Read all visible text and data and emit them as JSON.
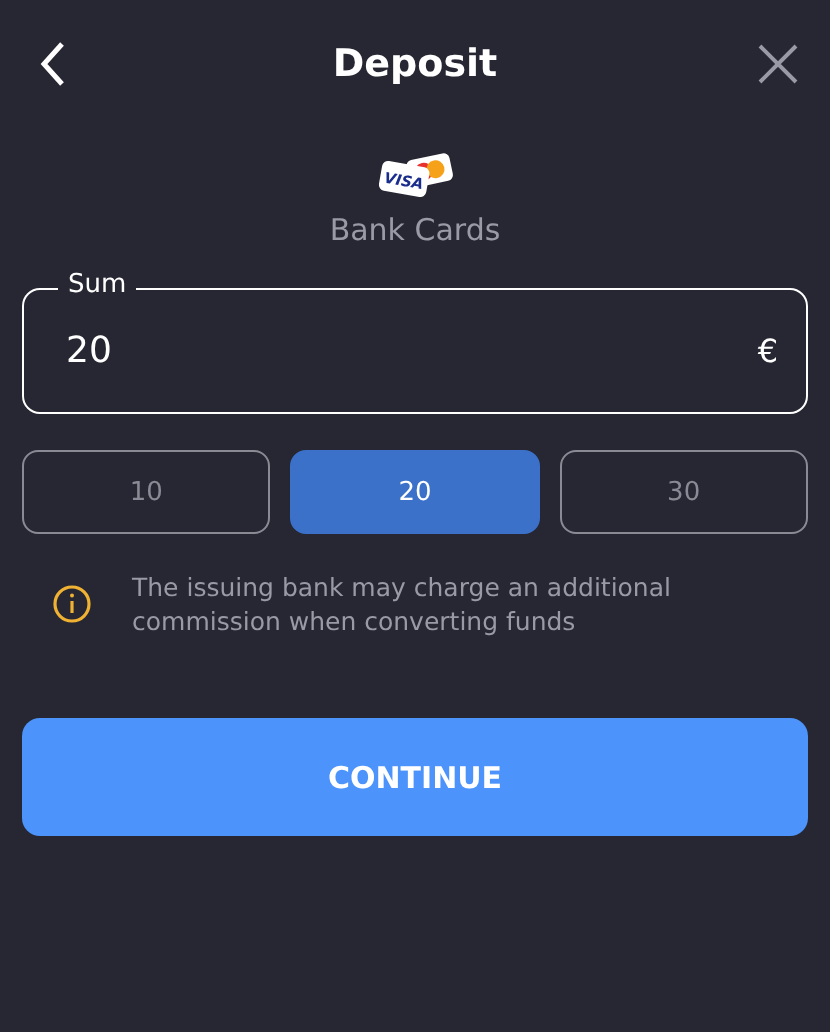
{
  "header": {
    "title": "Deposit"
  },
  "method": {
    "logo_text": "VISA",
    "label": "Bank Cards"
  },
  "sum_field": {
    "label": "Sum",
    "value": "20",
    "currency": "€"
  },
  "amounts": [
    {
      "label": "10",
      "selected": false
    },
    {
      "label": "20",
      "selected": true
    },
    {
      "label": "30",
      "selected": false
    }
  ],
  "notice": "The issuing bank may charge an additional commission when converting funds",
  "continue_button": "CONTINUE"
}
